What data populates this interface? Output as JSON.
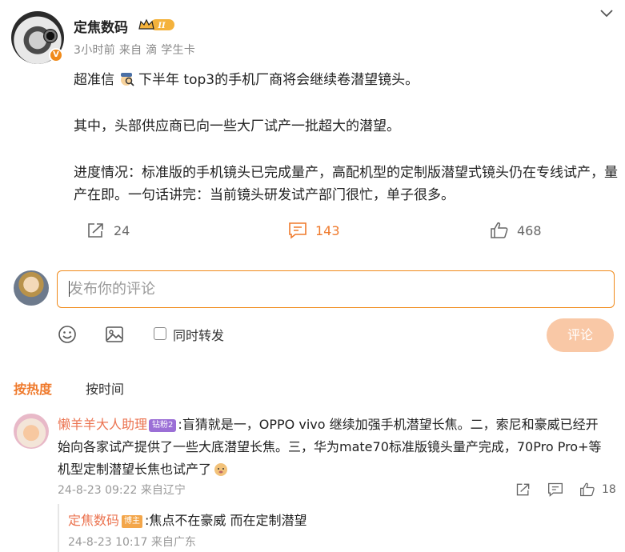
{
  "post": {
    "author": "定焦数码",
    "level_badge": "II",
    "meta": "3小时前 来自 滴 学生卡",
    "line1_pre": "超准信",
    "line1_post": "下半年 top3的手机厂商将会继续卷潜望镜头。",
    "line2": "其中，头部供应商已向一些大厂试产一批超大的潜望。",
    "line3": "进度情况：标准版的手机镜头已完成量产，高配机型的定制版潜望式镜头仍在专线试产，量产在即。一句话讲完：当前镜头研发试产部门很忙，单子很多。",
    "repost_count": "24",
    "comment_count": "143",
    "like_count": "468"
  },
  "composer": {
    "placeholder": "发布你的评论",
    "repost_checkbox_label": "同时转发",
    "submit_label": "评论"
  },
  "sort_tabs": {
    "hot": "按热度",
    "time": "按时间"
  },
  "comment": {
    "author": "懒羊羊大人助理",
    "fan_badge": "钻粉2",
    "text": ":盲猜就是一，OPPO vivo 继续加强手机潜望长焦。二，索尼和豪威已经开始向各家试产提供了一些大底潜望长焦。三，华为mate70标准版镜头量产完成，70Pro Pro+等机型定制潜望长焦也试产了",
    "meta": "24-8-23 09:22 来自辽宁",
    "like_count": "18"
  },
  "reply": {
    "author": "定焦数码",
    "host_badge": "博主",
    "text": ":焦点不在豪威 而在定制潜望",
    "meta": "24-8-23 10:17 来自广东"
  },
  "icons": {
    "collapse": "chevron-down-icon",
    "verified": "v-badge-icon",
    "repost": "share-arrow-icon",
    "comment": "comment-bubble-icon",
    "like": "thumbs-up-icon",
    "emoji": "smiley-icon",
    "image": "image-icon"
  },
  "colors": {
    "accent": "#ef7a2c",
    "submit_disabled": "#f9c8a6",
    "username": "#eb7350"
  }
}
